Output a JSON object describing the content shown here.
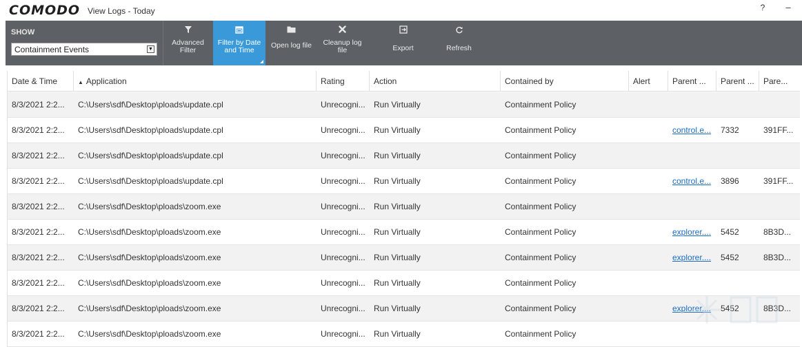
{
  "window": {
    "logo": "COMODO",
    "title": "View Logs - Today",
    "help": "?",
    "minimize": "–"
  },
  "toolbar": {
    "show_label": "SHOW",
    "show_value": "Containment Events",
    "buttons": [
      {
        "label": "Advanced\nFilter",
        "icon": "filter-icon"
      },
      {
        "label": "Filter by Date\nand Time",
        "icon": "calendar-icon",
        "active": true
      },
      {
        "label": "Open log file",
        "icon": "folder-icon"
      },
      {
        "label": "Cleanup log\nfile",
        "icon": "close-x-icon"
      },
      {
        "label": "Export",
        "icon": "export-icon"
      },
      {
        "label": "Refresh",
        "icon": "refresh-icon"
      }
    ],
    "bg_color": "#5d6165",
    "active_color": "#3a9ad9"
  },
  "table": {
    "columns": [
      "Date & Time",
      "Application",
      "Rating",
      "Action",
      "Contained by",
      "Alert",
      "Parent ...",
      "Parent ...",
      "Pare..."
    ],
    "sort_column": "Application",
    "sort_indicator": "▲",
    "rows": [
      {
        "date": "8/3/2021 2:2...",
        "app": "C:\\Users\\sdf\\Desktop\\ploads\\update.cpl",
        "rating": "Unrecogni...",
        "action": "Run Virtually",
        "contained": "Containment Policy",
        "alert": "",
        "parent1": "",
        "parent2": "",
        "parent3": ""
      },
      {
        "date": "8/3/2021 2:2...",
        "app": "C:\\Users\\sdf\\Desktop\\ploads\\update.cpl",
        "rating": "Unrecogni...",
        "action": "Run Virtually",
        "contained": "Containment Policy",
        "alert": "",
        "parent1": "control.e...",
        "parent2": "7332",
        "parent3": "391FF..."
      },
      {
        "date": "8/3/2021 2:2...",
        "app": "C:\\Users\\sdf\\Desktop\\ploads\\update.cpl",
        "rating": "Unrecogni...",
        "action": "Run Virtually",
        "contained": "Containment Policy",
        "alert": "",
        "parent1": "",
        "parent2": "",
        "parent3": ""
      },
      {
        "date": "8/3/2021 2:2...",
        "app": "C:\\Users\\sdf\\Desktop\\ploads\\update.cpl",
        "rating": "Unrecogni...",
        "action": "Run Virtually",
        "contained": "Containment Policy",
        "alert": "",
        "parent1": "control.e...",
        "parent2": "3896",
        "parent3": "391FF..."
      },
      {
        "date": "8/3/2021 2:2...",
        "app": "C:\\Users\\sdf\\Desktop\\ploads\\zoom.exe",
        "rating": "Unrecogni...",
        "action": "Run Virtually",
        "contained": "Containment Policy",
        "alert": "",
        "parent1": "",
        "parent2": "",
        "parent3": ""
      },
      {
        "date": "8/3/2021 2:2...",
        "app": "C:\\Users\\sdf\\Desktop\\ploads\\zoom.exe",
        "rating": "Unrecogni...",
        "action": "Run Virtually",
        "contained": "Containment Policy",
        "alert": "",
        "parent1": "explorer....",
        "parent2": "5452",
        "parent3": "8B3D..."
      },
      {
        "date": "8/3/2021 2:2...",
        "app": "C:\\Users\\sdf\\Desktop\\ploads\\zoom.exe",
        "rating": "Unrecogni...",
        "action": "Run Virtually",
        "contained": "Containment Policy",
        "alert": "",
        "parent1": "explorer....",
        "parent2": "5452",
        "parent3": "8B3D..."
      },
      {
        "date": "8/3/2021 2:2...",
        "app": "C:\\Users\\sdf\\Desktop\\ploads\\zoom.exe",
        "rating": "Unrecogni...",
        "action": "Run Virtually",
        "contained": "Containment Policy",
        "alert": "",
        "parent1": "",
        "parent2": "",
        "parent3": ""
      },
      {
        "date": "8/3/2021 2:2...",
        "app": "C:\\Users\\sdf\\Desktop\\ploads\\zoom.exe",
        "rating": "Unrecogni...",
        "action": "Run Virtually",
        "contained": "Containment Policy",
        "alert": "",
        "parent1": "explorer....",
        "parent2": "5452",
        "parent3": "8B3D..."
      },
      {
        "date": "8/3/2021 2:2...",
        "app": "C:\\Users\\sdf\\Desktop\\ploads\\zoom.exe",
        "rating": "Unrecogni...",
        "action": "Run Virtually",
        "contained": "Containment Policy",
        "alert": "",
        "parent1": "",
        "parent2": "",
        "parent3": ""
      }
    ]
  }
}
